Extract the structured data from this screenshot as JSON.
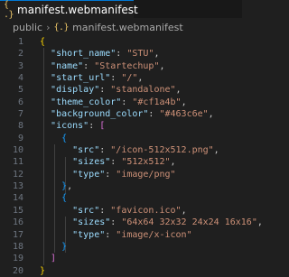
{
  "tab": {
    "icon": "json-braces-icon",
    "title": "manifest.webmanifest"
  },
  "breadcrumb": {
    "folder": "public",
    "file": "manifest.webmanifest"
  },
  "editor": {
    "lines": [
      {
        "n": "1",
        "t": [
          [
            "b1",
            "{"
          ]
        ]
      },
      {
        "n": "2",
        "t": [
          [
            "sp",
            "  "
          ],
          [
            "key",
            "\"short_name\""
          ],
          [
            "punc",
            ": "
          ],
          [
            "str",
            "\"STU\""
          ],
          [
            "punc",
            ","
          ]
        ]
      },
      {
        "n": "3",
        "t": [
          [
            "sp",
            "  "
          ],
          [
            "key",
            "\"name\""
          ],
          [
            "punc",
            ": "
          ],
          [
            "str",
            "\"Startechup\""
          ],
          [
            "punc",
            ","
          ]
        ]
      },
      {
        "n": "4",
        "t": [
          [
            "sp",
            "  "
          ],
          [
            "key",
            "\"start_url\""
          ],
          [
            "punc",
            ": "
          ],
          [
            "str",
            "\"/\""
          ],
          [
            "punc",
            ","
          ]
        ]
      },
      {
        "n": "5",
        "t": [
          [
            "sp",
            "  "
          ],
          [
            "key",
            "\"display\""
          ],
          [
            "punc",
            ": "
          ],
          [
            "str",
            "\"standalone\""
          ],
          [
            "punc",
            ","
          ]
        ]
      },
      {
        "n": "6",
        "t": [
          [
            "sp",
            "  "
          ],
          [
            "key",
            "\"theme_color\""
          ],
          [
            "punc",
            ": "
          ],
          [
            "str",
            "\"#cf1a4b\""
          ],
          [
            "punc",
            ","
          ]
        ]
      },
      {
        "n": "7",
        "t": [
          [
            "sp",
            "  "
          ],
          [
            "key",
            "\"background_color\""
          ],
          [
            "punc",
            ": "
          ],
          [
            "str",
            "\"#463c6e\""
          ],
          [
            "punc",
            ","
          ]
        ]
      },
      {
        "n": "8",
        "t": [
          [
            "sp",
            "  "
          ],
          [
            "key",
            "\"icons\""
          ],
          [
            "punc",
            ": "
          ],
          [
            "b2",
            "["
          ]
        ]
      },
      {
        "n": "9",
        "t": [
          [
            "sp",
            "    "
          ],
          [
            "b3",
            "{"
          ]
        ]
      },
      {
        "n": "10",
        "t": [
          [
            "sp",
            "      "
          ],
          [
            "key",
            "\"src\""
          ],
          [
            "punc",
            ": "
          ],
          [
            "str",
            "\"/icon-512x512.png\""
          ],
          [
            "punc",
            ","
          ]
        ]
      },
      {
        "n": "11",
        "t": [
          [
            "sp",
            "      "
          ],
          [
            "key",
            "\"sizes\""
          ],
          [
            "punc",
            ": "
          ],
          [
            "str",
            "\"512x512\""
          ],
          [
            "punc",
            ","
          ]
        ]
      },
      {
        "n": "12",
        "t": [
          [
            "sp",
            "      "
          ],
          [
            "key",
            "\"type\""
          ],
          [
            "punc",
            ": "
          ],
          [
            "str",
            "\"image/png\""
          ]
        ]
      },
      {
        "n": "13",
        "t": [
          [
            "sp",
            "    "
          ],
          [
            "b3",
            "}"
          ],
          [
            "punc",
            ","
          ]
        ]
      },
      {
        "n": "14",
        "t": [
          [
            "sp",
            "    "
          ],
          [
            "b3",
            "{"
          ]
        ]
      },
      {
        "n": "15",
        "t": [
          [
            "sp",
            "      "
          ],
          [
            "key",
            "\"src\""
          ],
          [
            "punc",
            ": "
          ],
          [
            "str",
            "\"favicon.ico\""
          ],
          [
            "punc",
            ","
          ]
        ]
      },
      {
        "n": "16",
        "t": [
          [
            "sp",
            "      "
          ],
          [
            "key",
            "\"sizes\""
          ],
          [
            "punc",
            ": "
          ],
          [
            "str",
            "\"64x64 32x32 24x24 16x16\""
          ],
          [
            "punc",
            ","
          ]
        ]
      },
      {
        "n": "17",
        "t": [
          [
            "sp",
            "      "
          ],
          [
            "key",
            "\"type\""
          ],
          [
            "punc",
            ": "
          ],
          [
            "str",
            "\"image/x-icon\""
          ]
        ]
      },
      {
        "n": "18",
        "t": [
          [
            "sp",
            "    "
          ],
          [
            "b3",
            "}"
          ]
        ]
      },
      {
        "n": "19",
        "t": [
          [
            "sp",
            "  "
          ],
          [
            "b2",
            "]"
          ]
        ]
      },
      {
        "n": "20",
        "t": [
          [
            "b1",
            "}"
          ]
        ]
      }
    ]
  }
}
